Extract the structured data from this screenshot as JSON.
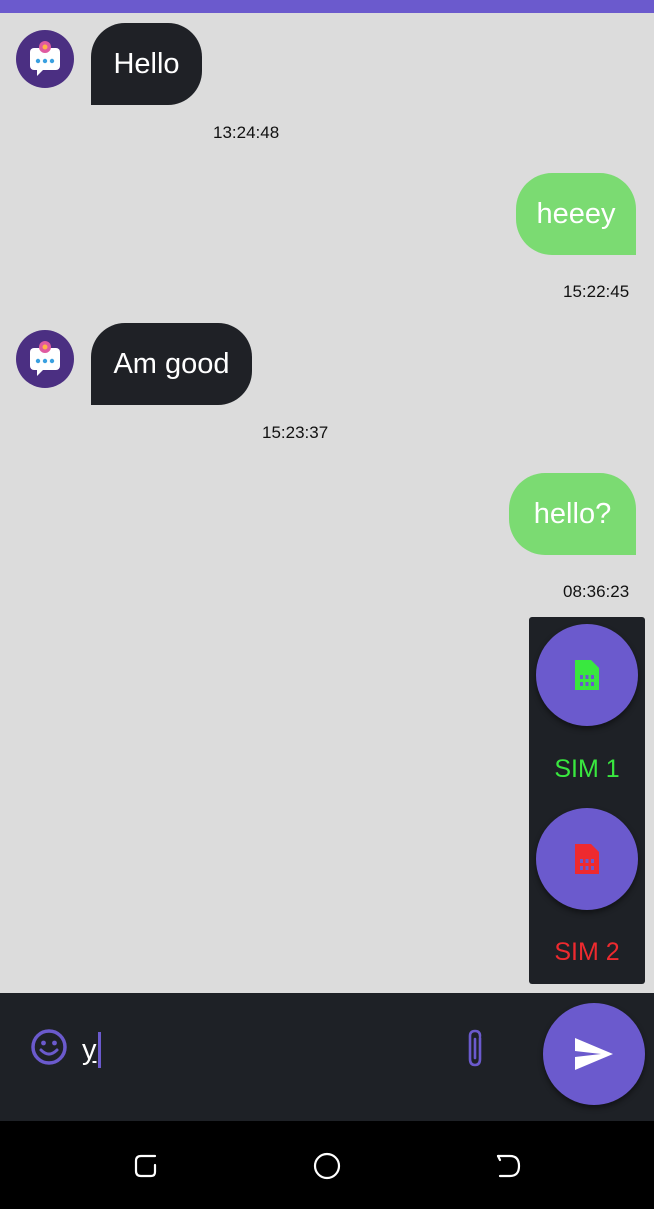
{
  "colors": {
    "accent": "#6b5acd",
    "incoming_bubble": "#1f2126",
    "outgoing_bubble": "#7bdb72",
    "background": "#dcdcdc",
    "sim1": "#39e83f",
    "sim2": "#ee2a2f"
  },
  "messages": [
    {
      "direction": "incoming",
      "text": "Hello",
      "time": "13:24:48",
      "avatar_icon": "chat-bot-icon"
    },
    {
      "direction": "outgoing",
      "text": "heeey",
      "time": "15:22:45"
    },
    {
      "direction": "incoming",
      "text": "Am good",
      "time": "15:23:37",
      "avatar_icon": "chat-bot-icon"
    },
    {
      "direction": "outgoing",
      "text": "hello?",
      "time": "08:36:23"
    }
  ],
  "sim_picker": {
    "options": [
      {
        "label": "SIM 1",
        "icon": "sim-card-icon",
        "color": "#39e83f"
      },
      {
        "label": "SIM 2",
        "icon": "sim-card-icon",
        "color": "#ee2a2f"
      }
    ]
  },
  "composer": {
    "value": "y",
    "emoji_icon": "emoji-icon",
    "attach_icon": "paperclip-icon",
    "send_icon": "send-icon"
  },
  "navbar": {
    "icons": [
      "recent-apps-icon",
      "home-icon",
      "back-icon"
    ]
  }
}
